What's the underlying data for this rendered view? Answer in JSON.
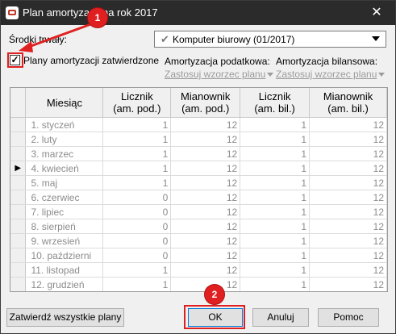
{
  "window": {
    "title": "Plan amortyzacji na rok 2017",
    "close_glyph": "✕"
  },
  "asset": {
    "label": "Środki trwały:",
    "selected": "Komputer biurowy (01/2017)"
  },
  "approved_checkbox": {
    "label": "Plany amortyzacji zatwierdzone",
    "checked": true
  },
  "tax": {
    "label": "Amortyzacja podatkowa:",
    "link": "Zastosuj wzorzec planu"
  },
  "balance": {
    "label": "Amortyzacja bilansowa:",
    "link": "Zastosuj wzorzec planu"
  },
  "table": {
    "headers": {
      "month": "Miesiąc",
      "tax_num": "Licznik\n(am. pod.)",
      "tax_den": "Mianownik\n(am. pod.)",
      "bal_num": "Licznik\n(am. bil.)",
      "bal_den": "Mianownik\n(am. bil.)"
    },
    "current_row_marker": "▶",
    "rows": [
      {
        "month": "1. styczeń",
        "tax_num": "1",
        "tax_den": "12",
        "bal_num": "1",
        "bal_den": "12"
      },
      {
        "month": "2. luty",
        "tax_num": "1",
        "tax_den": "12",
        "bal_num": "1",
        "bal_den": "12"
      },
      {
        "month": "3. marzec",
        "tax_num": "1",
        "tax_den": "12",
        "bal_num": "1",
        "bal_den": "12"
      },
      {
        "month": "4. kwiecień",
        "tax_num": "1",
        "tax_den": "12",
        "bal_num": "1",
        "bal_den": "12",
        "current": true
      },
      {
        "month": "5. maj",
        "tax_num": "1",
        "tax_den": "12",
        "bal_num": "1",
        "bal_den": "12"
      },
      {
        "month": "6. czerwiec",
        "tax_num": "0",
        "tax_den": "12",
        "bal_num": "1",
        "bal_den": "12"
      },
      {
        "month": "7. lipiec",
        "tax_num": "0",
        "tax_den": "12",
        "bal_num": "1",
        "bal_den": "12"
      },
      {
        "month": "8. sierpień",
        "tax_num": "0",
        "tax_den": "12",
        "bal_num": "1",
        "bal_den": "12"
      },
      {
        "month": "9. wrzesień",
        "tax_num": "0",
        "tax_den": "12",
        "bal_num": "1",
        "bal_den": "12"
      },
      {
        "month": "10. październi",
        "tax_num": "0",
        "tax_den": "12",
        "bal_num": "1",
        "bal_den": "12"
      },
      {
        "month": "11. listopad",
        "tax_num": "1",
        "tax_den": "12",
        "bal_num": "1",
        "bal_den": "12"
      },
      {
        "month": "12. grudzień",
        "tax_num": "1",
        "tax_den": "12",
        "bal_num": "1",
        "bal_den": "12"
      }
    ]
  },
  "buttons": {
    "approve_all": "Zatwierdź wszystkie plany",
    "ok": "OK",
    "cancel": "Anuluj",
    "help": "Pomoc"
  },
  "annotations": {
    "badge1": "1",
    "badge2": "2",
    "color": "#e02020"
  }
}
